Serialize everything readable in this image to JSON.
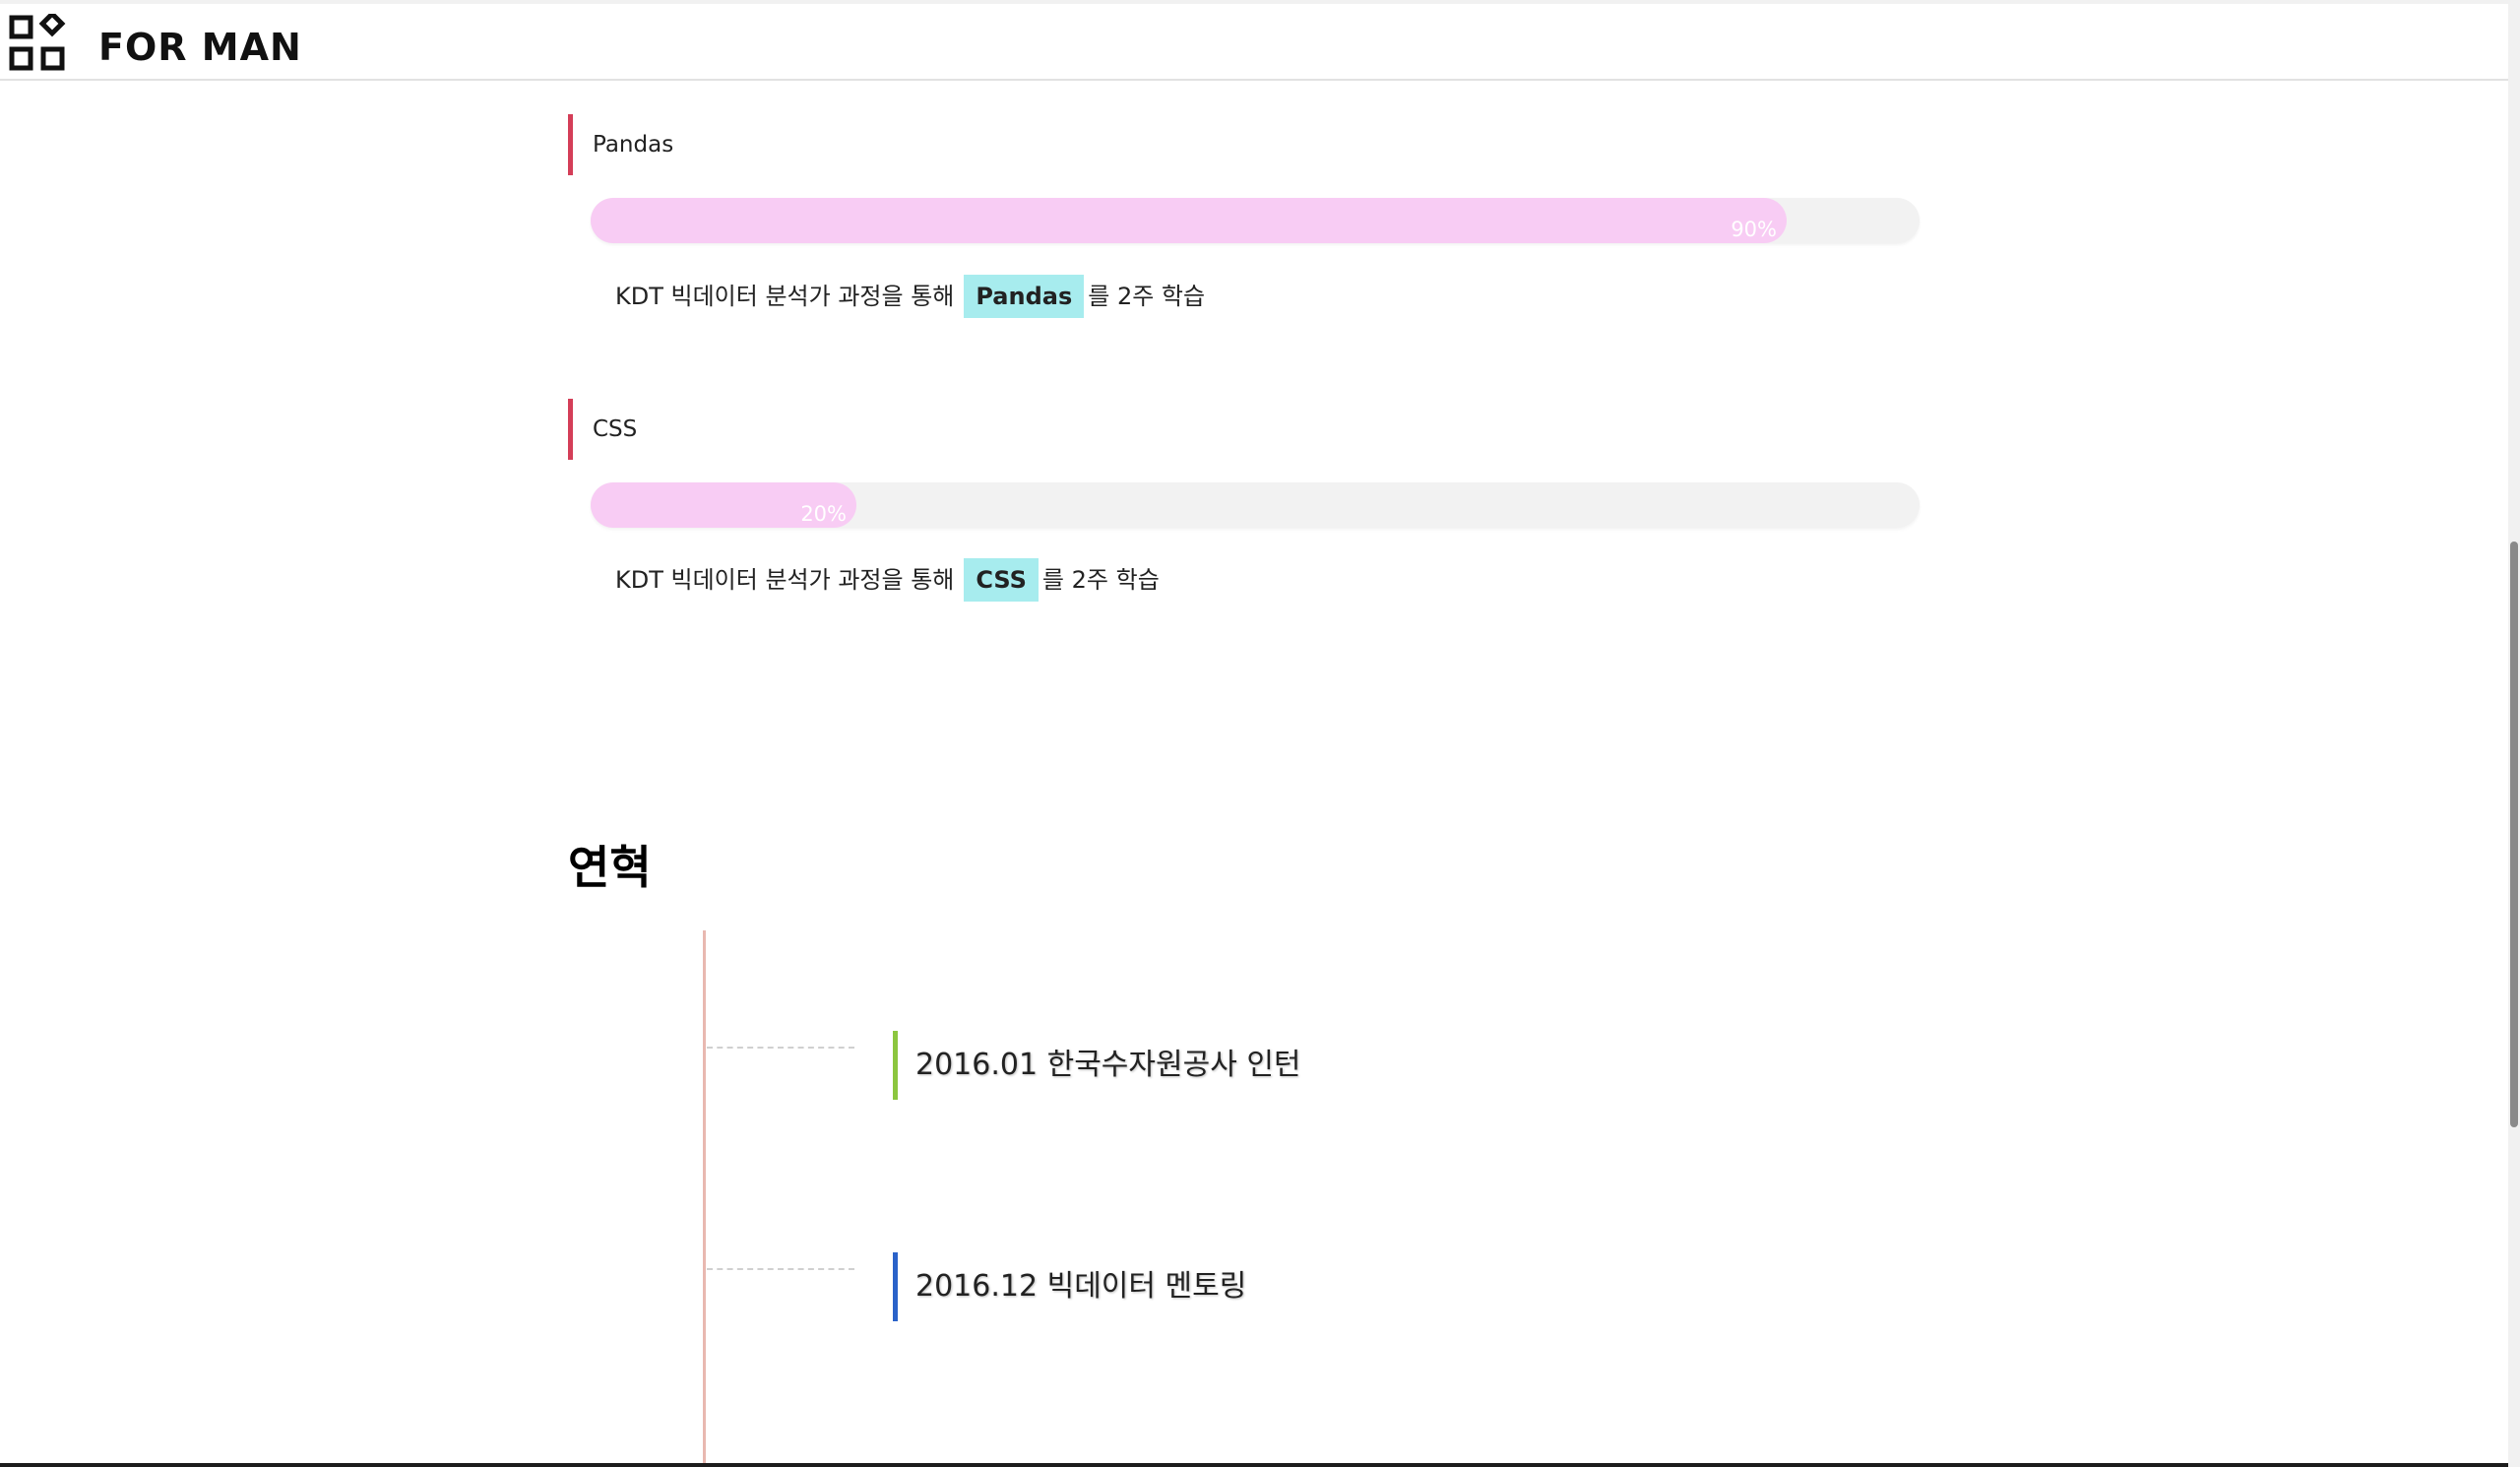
{
  "header": {
    "brand": "FOR MAN",
    "logo_icon": "apps-grid-icon"
  },
  "skills": [
    {
      "name": "Pandas",
      "progress_percent": 90,
      "progress_label": "90%",
      "desc_prefix": "KDT 빅데이터 분석가 과정을 통해",
      "desc_highlight": "Pandas",
      "desc_suffix": "를 2주 학습"
    },
    {
      "name": "CSS",
      "progress_percent": 20,
      "progress_label": "20%",
      "desc_prefix": "KDT 빅데이터 분석가 과정을 통해",
      "desc_highlight": "CSS",
      "desc_suffix": "를 2주 학습"
    }
  ],
  "history": {
    "title": "연혁",
    "items": [
      {
        "text": "2016.01 한국수자원공사 인턴",
        "accent": "#8cc63f"
      },
      {
        "text": "2016.12 빅데이터 멘토링",
        "accent": "#2a62c9"
      }
    ]
  },
  "colors": {
    "skill_accent": "#d43e58",
    "bar_fill": "#f8ccf4",
    "bar_track": "#f2f2f2",
    "highlight": "#a7ecee",
    "timeline_line": "#e8b8b0"
  }
}
